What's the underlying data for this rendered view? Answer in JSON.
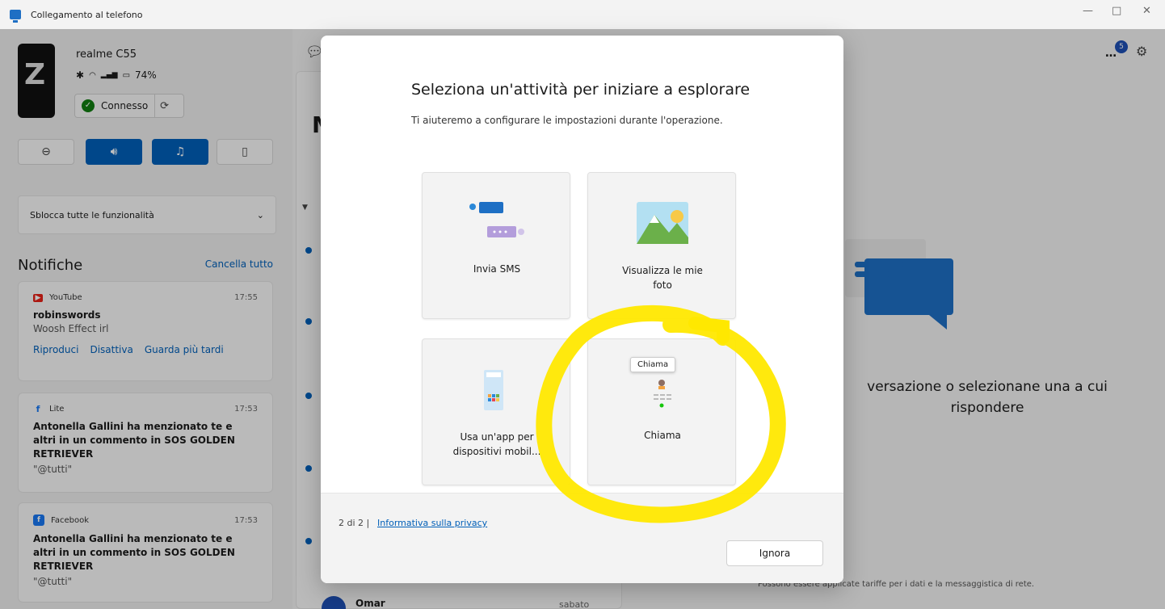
{
  "window": {
    "title": "Collegamento al telefono",
    "minimize": "—",
    "maximize": "□",
    "close": "✕"
  },
  "device": {
    "name": "realme C55",
    "battery": "74%",
    "status_label": "Connesso"
  },
  "unlock": {
    "label": "Sblocca tutte le funzionalità"
  },
  "notifications": {
    "title": "Notifiche",
    "clear_all": "Cancella tutto",
    "items": [
      {
        "app": "YouTube",
        "time": "17:55",
        "title": "robinswords",
        "body": "Woosh Effect irl",
        "actions": [
          "Riproduci",
          "Disattiva",
          "Guarda più tardi"
        ]
      },
      {
        "app": "Lite",
        "time": "17:53",
        "title": "Antonella Gallini ha menzionato te e altri in un commento in SOS GOLDEN RETRIEVER",
        "body": "\"@tutti\""
      },
      {
        "app": "Facebook",
        "time": "17:53",
        "title": "Antonella Gallini ha menzionato te e altri in un commento in SOS GOLDEN RETRIEVER",
        "body": "\"@tutti\""
      }
    ]
  },
  "messages": {
    "header_letter": "M",
    "conversation": {
      "name": "Omar",
      "date": "sabato"
    }
  },
  "right": {
    "badge_count": "5",
    "empty_line1": "versazione o selezionane una a cui",
    "empty_line2": "rispondere",
    "rates": "Possono essere applicate tariffe per i dati e la messaggistica di rete."
  },
  "modal": {
    "title": "Seleziona un'attività per iniziare a esplorare",
    "subtitle": "Ti aiuteremo a configurare le impostazioni durante l'operazione.",
    "tiles": [
      {
        "label": "Invia SMS"
      },
      {
        "label_line1": "Visualizza le mie",
        "label_line2": "foto"
      },
      {
        "label_line1": "Usa un'app per",
        "label_line2": "dispositivi mobil..."
      },
      {
        "label": "Chiama"
      }
    ],
    "tooltip": "Chiama",
    "step": "2 di 2",
    "step_sep": "|",
    "privacy": "Informativa sulla privacy",
    "ignore": "Ignora"
  },
  "colors": {
    "accent": "#005fb8",
    "highlight": "#ffe800"
  }
}
